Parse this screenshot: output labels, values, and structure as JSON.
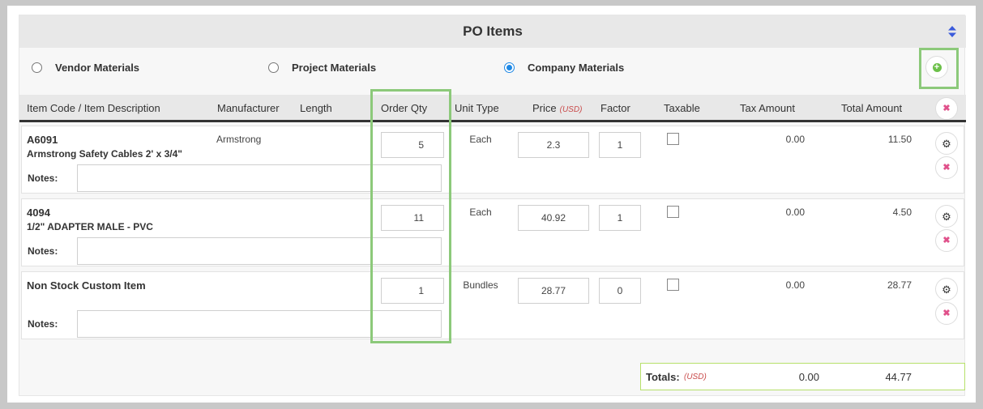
{
  "panel": {
    "title": "PO Items"
  },
  "radios": [
    {
      "label": "Vendor Materials",
      "selected": false
    },
    {
      "label": "Project Materials",
      "selected": false
    },
    {
      "label": "Company Materials",
      "selected": true
    }
  ],
  "columns": {
    "item": "Item Code / Item Description",
    "manufacturer": "Manufacturer",
    "length": "Length",
    "order_qty": "Order Qty",
    "unit_type": "Unit Type",
    "price": "Price",
    "price_currency": "(USD)",
    "factor": "Factor",
    "taxable": "Taxable",
    "tax_amount": "Tax Amount",
    "total_amount": "Total Amount"
  },
  "rows": [
    {
      "code": "A6091",
      "description": "Armstrong Safety Cables 2' x 3/4\"",
      "manufacturer": "Armstrong",
      "length": "",
      "qty": "5",
      "unit": "Each",
      "price": "2.3",
      "factor": "1",
      "taxable": false,
      "tax": "0.00",
      "total": "11.50",
      "notes_label": "Notes:",
      "notes": ""
    },
    {
      "code": "4094",
      "description": "1/2\" ADAPTER MALE - PVC",
      "manufacturer": "",
      "length": "",
      "qty": "11",
      "unit": "Each",
      "price": "40.92",
      "factor": "1",
      "taxable": false,
      "tax": "0.00",
      "total": "4.50",
      "notes_label": "Notes:",
      "notes": ""
    },
    {
      "code": "Non Stock Custom Item",
      "description": "",
      "manufacturer": "",
      "length": "",
      "qty": "1",
      "unit": "Bundles",
      "price": "28.77",
      "factor": "0",
      "taxable": false,
      "tax": "0.00",
      "total": "28.77",
      "notes_label": "Notes:",
      "notes": ""
    }
  ],
  "totals": {
    "label": "Totals:",
    "currency": "(USD)",
    "tax": "0.00",
    "total": "44.77"
  },
  "icons": {
    "sort": "sort-arrows-icon",
    "add": "plus-circle-icon",
    "remove": "x-icon",
    "settings": "gear-icon"
  },
  "colors": {
    "accent_radio": "#1e88e5",
    "add_green": "#6cc04a",
    "remove_pink": "#e0508a",
    "highlight": "#8cc97a",
    "currency_red": "#c94a4a"
  }
}
